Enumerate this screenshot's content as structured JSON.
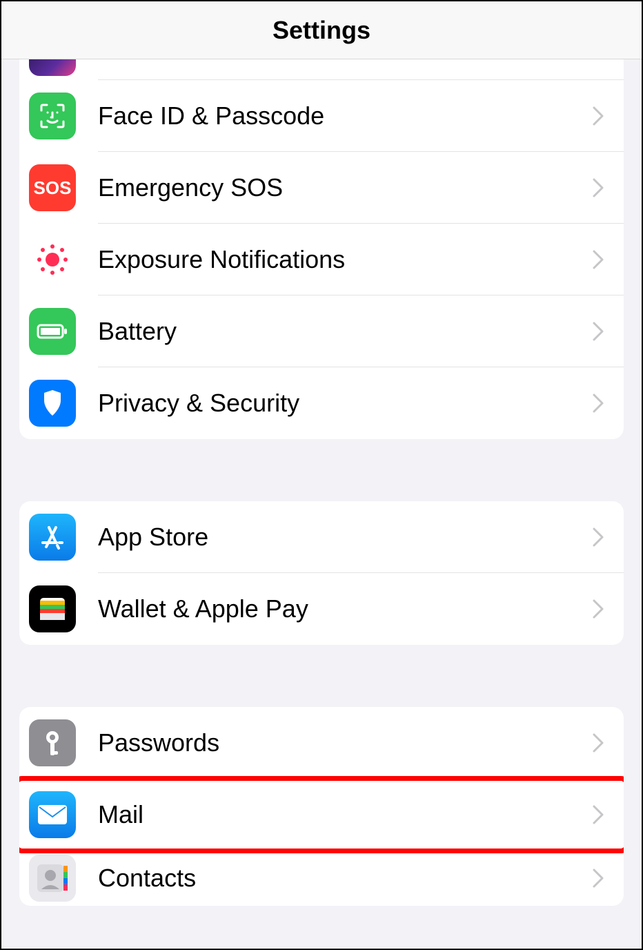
{
  "header": {
    "title": "Settings"
  },
  "groups": [
    {
      "rows": [
        {
          "id": "appearance",
          "label": "",
          "icon": "appearance",
          "partial": true
        },
        {
          "id": "faceid",
          "label": "Face ID & Passcode",
          "icon": "faceid"
        },
        {
          "id": "sos",
          "label": "Emergency SOS",
          "icon": "sos"
        },
        {
          "id": "exposure",
          "label": "Exposure Notifications",
          "icon": "exposure"
        },
        {
          "id": "battery",
          "label": "Battery",
          "icon": "battery"
        },
        {
          "id": "privacy",
          "label": "Privacy & Security",
          "icon": "privacy"
        }
      ]
    },
    {
      "rows": [
        {
          "id": "appstore",
          "label": "App Store",
          "icon": "appstore"
        },
        {
          "id": "wallet",
          "label": "Wallet & Apple Pay",
          "icon": "wallet"
        }
      ]
    },
    {
      "rows": [
        {
          "id": "passwords",
          "label": "Passwords",
          "icon": "passwords"
        },
        {
          "id": "mail",
          "label": "Mail",
          "icon": "mail",
          "highlighted": true
        },
        {
          "id": "contacts",
          "label": "Contacts",
          "icon": "contacts"
        }
      ]
    }
  ],
  "sos_text": "SOS"
}
